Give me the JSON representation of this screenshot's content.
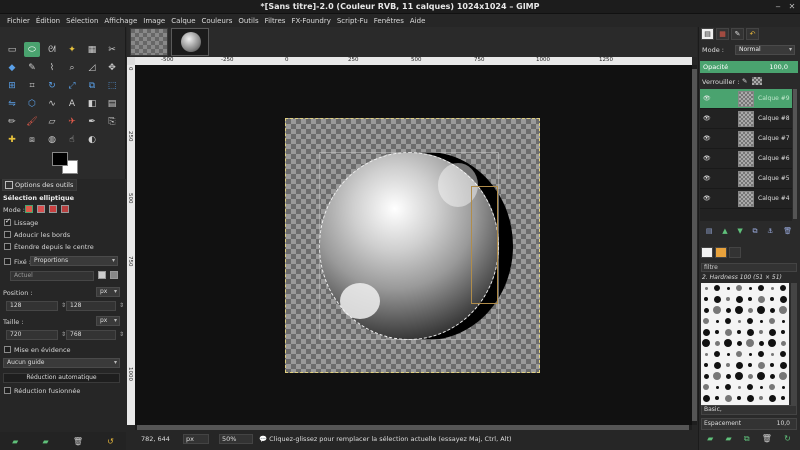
{
  "window": {
    "title": "*[Sans titre]-2.0 (Couleur RVB, 11 calques) 1024x1024 – GIMP",
    "controls": [
      "‒",
      "✕"
    ]
  },
  "menubar": [
    "Fichier",
    "Édition",
    "Sélection",
    "Affichage",
    "Image",
    "Calque",
    "Couleurs",
    "Outils",
    "Filtres",
    "FX-Foundry",
    "Script-Fu",
    "Fenêtres",
    "Aide"
  ],
  "toolbox": {
    "tools": [
      {
        "name": "rect-select-tool",
        "glyph": "▭",
        "cls": ""
      },
      {
        "name": "ellipse-select-tool",
        "glyph": "⬭",
        "cls": "sel"
      },
      {
        "name": "free-select-tool",
        "glyph": "ᘛ",
        "cls": ""
      },
      {
        "name": "fuzzy-select-tool",
        "glyph": "✦",
        "cls": "yellow"
      },
      {
        "name": "color-select-tool",
        "glyph": "▦",
        "cls": ""
      },
      {
        "name": "scissors-tool",
        "glyph": "✂",
        "cls": ""
      },
      {
        "name": "foreground-select-tool",
        "glyph": "◆",
        "cls": "blue"
      },
      {
        "name": "paths-tool",
        "glyph": "✎",
        "cls": ""
      },
      {
        "name": "color-picker-tool",
        "glyph": "⌇",
        "cls": ""
      },
      {
        "name": "zoom-tool",
        "glyph": "⌕",
        "cls": ""
      },
      {
        "name": "measure-tool",
        "glyph": "◿",
        "cls": ""
      },
      {
        "name": "move-tool",
        "glyph": "✥",
        "cls": ""
      },
      {
        "name": "align-tool",
        "glyph": "⊞",
        "cls": "blue"
      },
      {
        "name": "crop-tool",
        "glyph": "⌗",
        "cls": ""
      },
      {
        "name": "rotate-tool",
        "glyph": "↻",
        "cls": "blue"
      },
      {
        "name": "scale-tool",
        "glyph": "⤢",
        "cls": "blue"
      },
      {
        "name": "shear-tool",
        "glyph": "⧉",
        "cls": "blue"
      },
      {
        "name": "perspective-tool",
        "glyph": "⬚",
        "cls": "blue"
      },
      {
        "name": "flip-tool",
        "glyph": "⇋",
        "cls": "blue"
      },
      {
        "name": "cage-tool",
        "glyph": "⬡",
        "cls": "blue"
      },
      {
        "name": "warp-tool",
        "glyph": "∿",
        "cls": ""
      },
      {
        "name": "text-tool",
        "glyph": "A",
        "cls": ""
      },
      {
        "name": "bucket-fill-tool",
        "glyph": "◧",
        "cls": ""
      },
      {
        "name": "blend-tool",
        "glyph": "▤",
        "cls": ""
      },
      {
        "name": "pencil-tool",
        "glyph": "✏",
        "cls": ""
      },
      {
        "name": "paintbrush-tool",
        "glyph": "🖌",
        "cls": "red"
      },
      {
        "name": "eraser-tool",
        "glyph": "▱",
        "cls": ""
      },
      {
        "name": "airbrush-tool",
        "glyph": "✈",
        "cls": "red"
      },
      {
        "name": "ink-tool",
        "glyph": "✒",
        "cls": ""
      },
      {
        "name": "clone-tool",
        "glyph": "⎘",
        "cls": ""
      },
      {
        "name": "heal-tool",
        "glyph": "✚",
        "cls": "yellow"
      },
      {
        "name": "perspective-clone-tool",
        "glyph": "⧈",
        "cls": ""
      },
      {
        "name": "blur-tool",
        "glyph": "◍",
        "cls": ""
      },
      {
        "name": "smudge-tool",
        "glyph": "☝",
        "cls": ""
      },
      {
        "name": "dodge-burn-tool",
        "glyph": "◐",
        "cls": ""
      }
    ]
  },
  "tool_options": {
    "tab_label": "Options des outils",
    "title": "Sélection elliptique",
    "mode_label": "Mode :",
    "antialias": "Lissage",
    "feather": "Adoucir les bords",
    "expand_center": "Étendre depuis le centre",
    "fixed_label": "Fixé :",
    "fixed_value": "Proportions",
    "current": "Actuel",
    "position_label": "Position :",
    "position_unit": "px",
    "position_x": "128",
    "position_y": "128",
    "size_label": "Taille :",
    "size_unit": "px",
    "size_w": "720",
    "size_h": "768",
    "highlight": "Mise en évidence",
    "guides": "Aucun guide",
    "auto_shrink": "Réduction automatique",
    "shrink_merged": "Réduction fusionnée"
  },
  "canvas": {
    "ruler_top": [
      "-500",
      "-250",
      "0",
      "250",
      "500",
      "750",
      "1000",
      "1250"
    ],
    "ruler_left": [
      "0",
      "250",
      "500",
      "750",
      "1000"
    ]
  },
  "status": {
    "coords": "782, 644",
    "unit": "px",
    "zoom": "50%",
    "message": "Cliquez-glissez pour remplacer la sélection actuelle (essayez Maj, Ctrl, Alt)"
  },
  "layers_panel": {
    "mode_label": "Mode :",
    "mode_value": "Normal",
    "opacity_label": "Opacité",
    "opacity_value": "100,0",
    "lock_label": "Verrouiller :",
    "layers": [
      "Calque #9",
      "Calque #8",
      "Calque #7",
      "Calque #6",
      "Calque #5",
      "Calque #4"
    ],
    "selected_index": 0,
    "accent_color": "#4aa36f"
  },
  "brushes_panel": {
    "filter": "filtre",
    "brush_name": "2. Hardness 100 (51 × 51)",
    "set": "Basic,",
    "spacing_label": "Espacement",
    "spacing_value": "10,0"
  }
}
